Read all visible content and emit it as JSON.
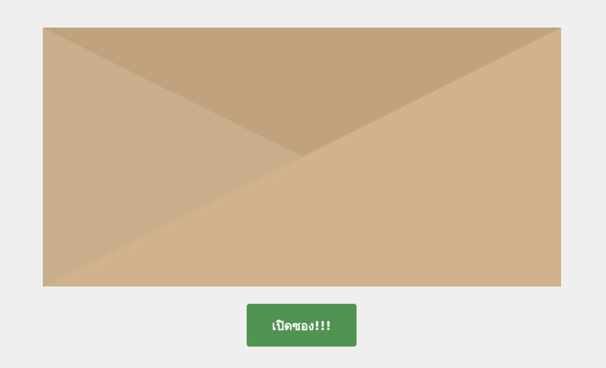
{
  "envelope": {
    "colors": {
      "body": "#d0b38c",
      "left_flap": "#c9ae8c",
      "top_flap": "#c0a27f"
    }
  },
  "open_button": {
    "label": "เปิดซอง!!!",
    "color": "#4f9450"
  },
  "page": {
    "background": "#efefef"
  }
}
